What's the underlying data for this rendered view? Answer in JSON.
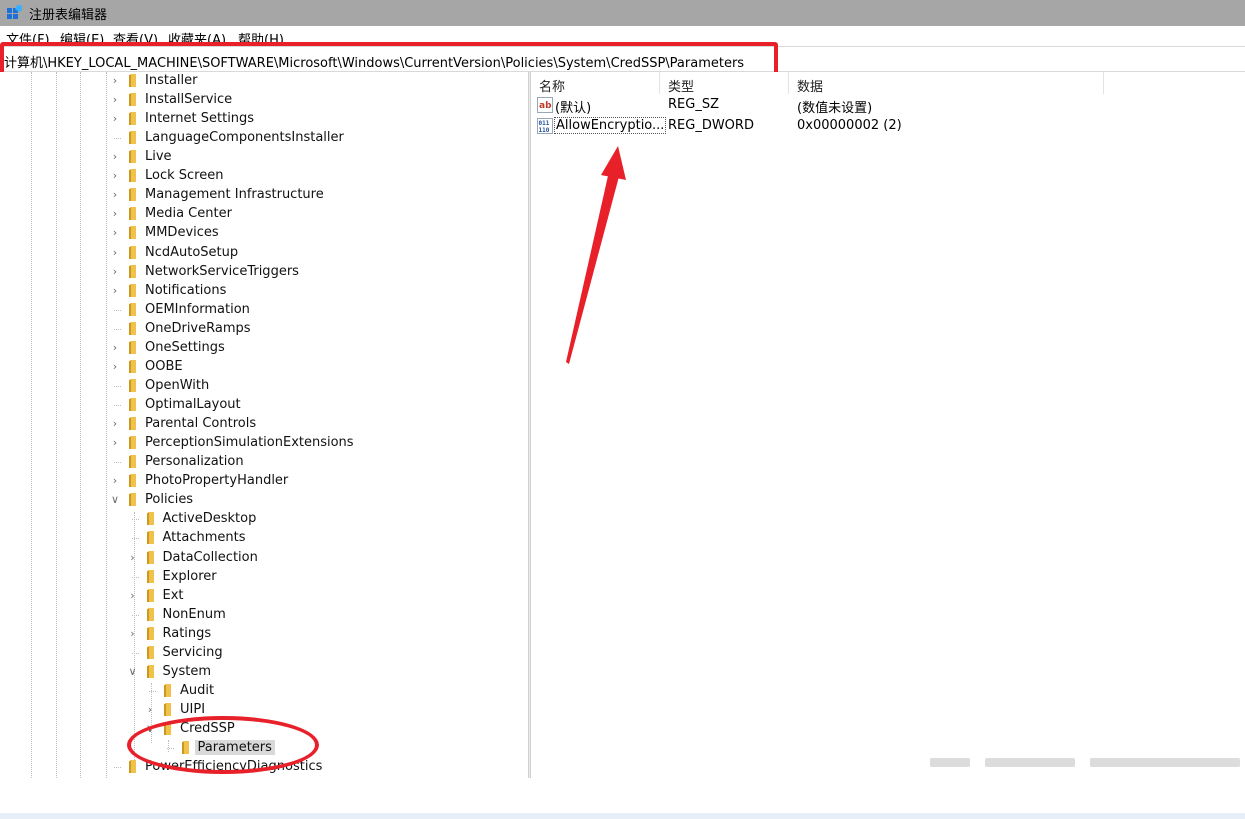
{
  "window": {
    "title": "注册表编辑器"
  },
  "menu": [
    {
      "label": "文件(F)"
    },
    {
      "label": "编辑(E)"
    },
    {
      "label": "查看(V)"
    },
    {
      "label": "收藏夹(A)"
    },
    {
      "label": "帮助(H)"
    }
  ],
  "address": {
    "path": "计算机\\HKEY_LOCAL_MACHINE\\SOFTWARE\\Microsoft\\Windows\\CurrentVersion\\Policies\\System\\CredSSP\\Parameters"
  },
  "tree": [
    {
      "label": "Installer",
      "expander": "collapsed"
    },
    {
      "label": "InstallService",
      "expander": "collapsed"
    },
    {
      "label": "Internet Settings",
      "expander": "collapsed"
    },
    {
      "label": "LanguageComponentsInstaller",
      "expander": "none"
    },
    {
      "label": "Live",
      "expander": "collapsed"
    },
    {
      "label": "Lock Screen",
      "expander": "collapsed"
    },
    {
      "label": "Management Infrastructure",
      "expander": "collapsed"
    },
    {
      "label": "Media Center",
      "expander": "collapsed"
    },
    {
      "label": "MMDevices",
      "expander": "collapsed"
    },
    {
      "label": "NcdAutoSetup",
      "expander": "collapsed"
    },
    {
      "label": "NetworkServiceTriggers",
      "expander": "collapsed"
    },
    {
      "label": "Notifications",
      "expander": "collapsed"
    },
    {
      "label": "OEMInformation",
      "expander": "none"
    },
    {
      "label": "OneDriveRamps",
      "expander": "none"
    },
    {
      "label": "OneSettings",
      "expander": "collapsed"
    },
    {
      "label": "OOBE",
      "expander": "collapsed"
    },
    {
      "label": "OpenWith",
      "expander": "none"
    },
    {
      "label": "OptimalLayout",
      "expander": "none"
    },
    {
      "label": "Parental Controls",
      "expander": "collapsed"
    },
    {
      "label": "PerceptionSimulationExtensions",
      "expander": "collapsed"
    },
    {
      "label": "Personalization",
      "expander": "none"
    },
    {
      "label": "PhotoPropertyHandler",
      "expander": "collapsed"
    },
    {
      "label": "Policies",
      "expander": "expanded"
    },
    {
      "label": "ActiveDesktop",
      "expander": "none"
    },
    {
      "label": "Attachments",
      "expander": "none"
    },
    {
      "label": "DataCollection",
      "expander": "collapsed"
    },
    {
      "label": "Explorer",
      "expander": "none"
    },
    {
      "label": "Ext",
      "expander": "collapsed"
    },
    {
      "label": "NonEnum",
      "expander": "none"
    },
    {
      "label": "Ratings",
      "expander": "collapsed"
    },
    {
      "label": "Servicing",
      "expander": "none"
    },
    {
      "label": "System",
      "expander": "expanded"
    },
    {
      "label": "Audit",
      "expander": "none"
    },
    {
      "label": "UIPI",
      "expander": "collapsed"
    },
    {
      "label": "CredSSP",
      "expander": "expanded"
    },
    {
      "label": "Parameters",
      "expander": "none",
      "selected": true
    },
    {
      "label": "PowerEfficiencyDiagnostics",
      "expander": "none"
    }
  ],
  "list": {
    "columns": {
      "name": "名称",
      "type": "类型",
      "data": "数据"
    },
    "rows": [
      {
        "name": "(默认)",
        "type": "REG_SZ",
        "data": "(数值未设置)",
        "icon": "string-value-icon"
      },
      {
        "name": "AllowEncryptio...",
        "type": "REG_DWORD",
        "data": "0x00000002 (2)",
        "icon": "dword-value-icon"
      }
    ]
  },
  "colors": {
    "annotation": "#e8202a",
    "folder": "#f0c24b",
    "titlebar": "#a6a6a6"
  }
}
